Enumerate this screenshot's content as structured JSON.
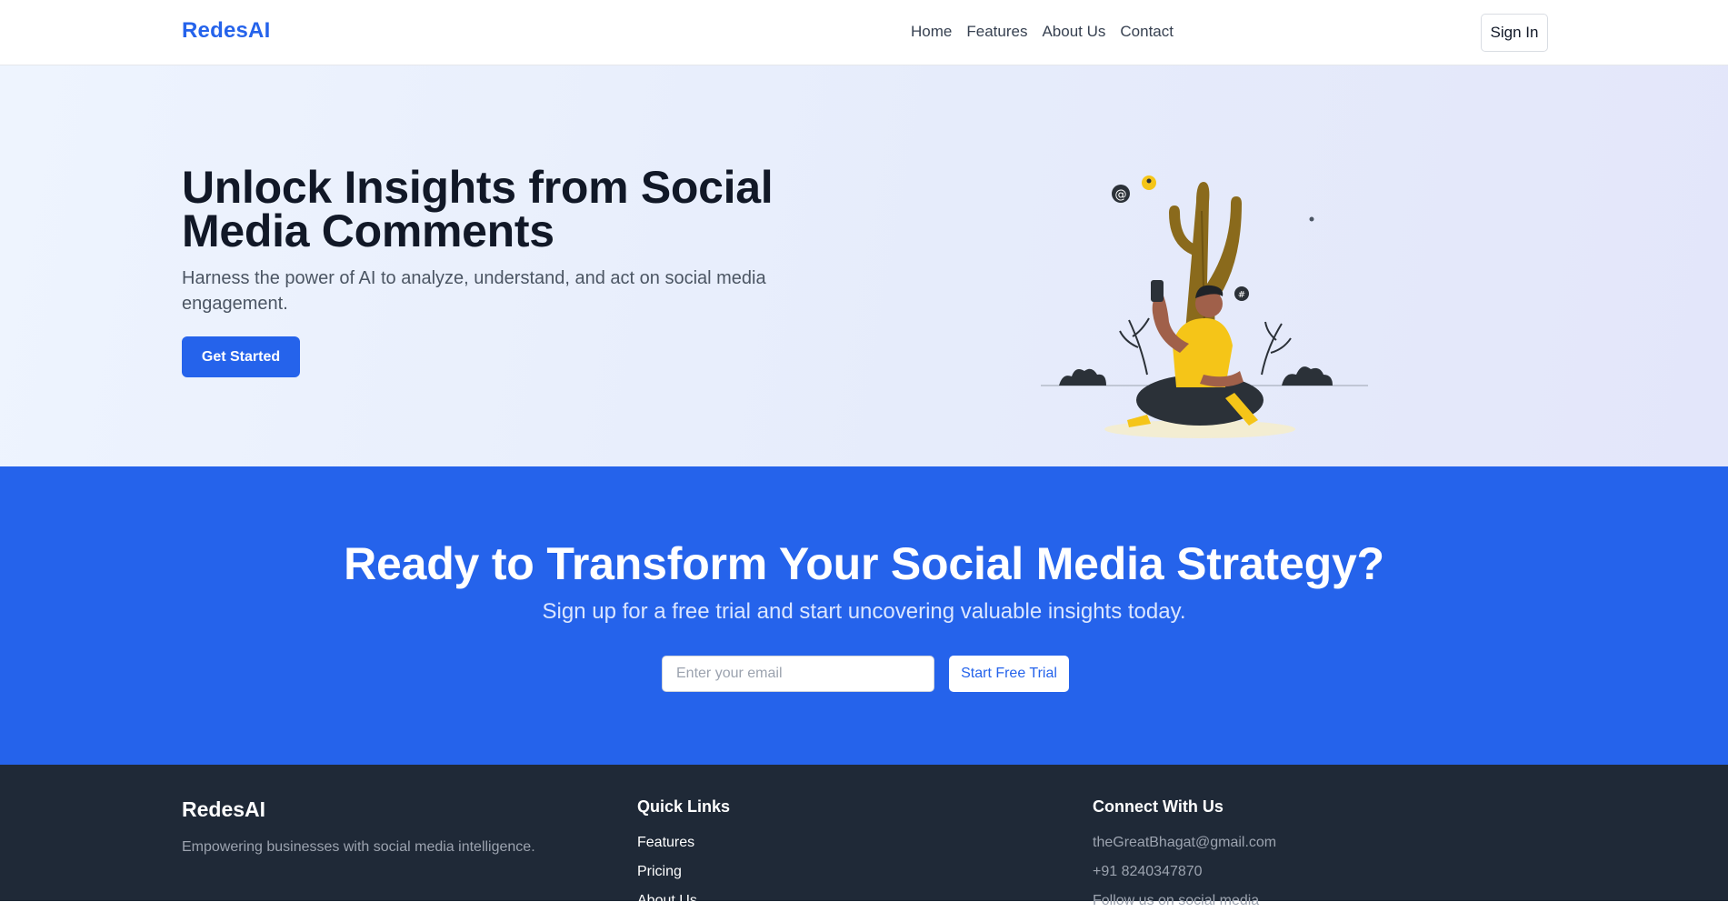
{
  "nav": {
    "logo": "RedesAI",
    "links": [
      "Home",
      "Features",
      "About Us",
      "Contact"
    ],
    "signin_label": "Sign In"
  },
  "hero": {
    "title": "Unlock Insights from Social Media Comments",
    "subtitle": "Harness the power of AI to analyze, understand, and act on social media engagement.",
    "cta_label": "Get Started",
    "illustration": "person-with-phone-under-tree-illustration"
  },
  "cta": {
    "title": "Ready to Transform Your Social Media Strategy?",
    "subtitle": "Sign up for a free trial and start uncovering valuable insights today.",
    "email_placeholder": "Enter your email",
    "button_label": "Start Free Trial"
  },
  "footer": {
    "brand": "RedesAI",
    "tagline": "Empowering businesses with social media intelligence.",
    "quick_links": {
      "heading": "Quick Links",
      "items": [
        "Features",
        "Pricing",
        "About Us"
      ]
    },
    "connect": {
      "heading": "Connect With Us",
      "items": [
        "theGreatBhagat@gmail.com",
        "+91 8240347870",
        "Follow us on social media"
      ]
    }
  },
  "colors": {
    "brand": "#2563eb",
    "hero_bg": "#e9effc",
    "footer_bg": "#1f2937",
    "illustration_accent": "#f5c518"
  }
}
